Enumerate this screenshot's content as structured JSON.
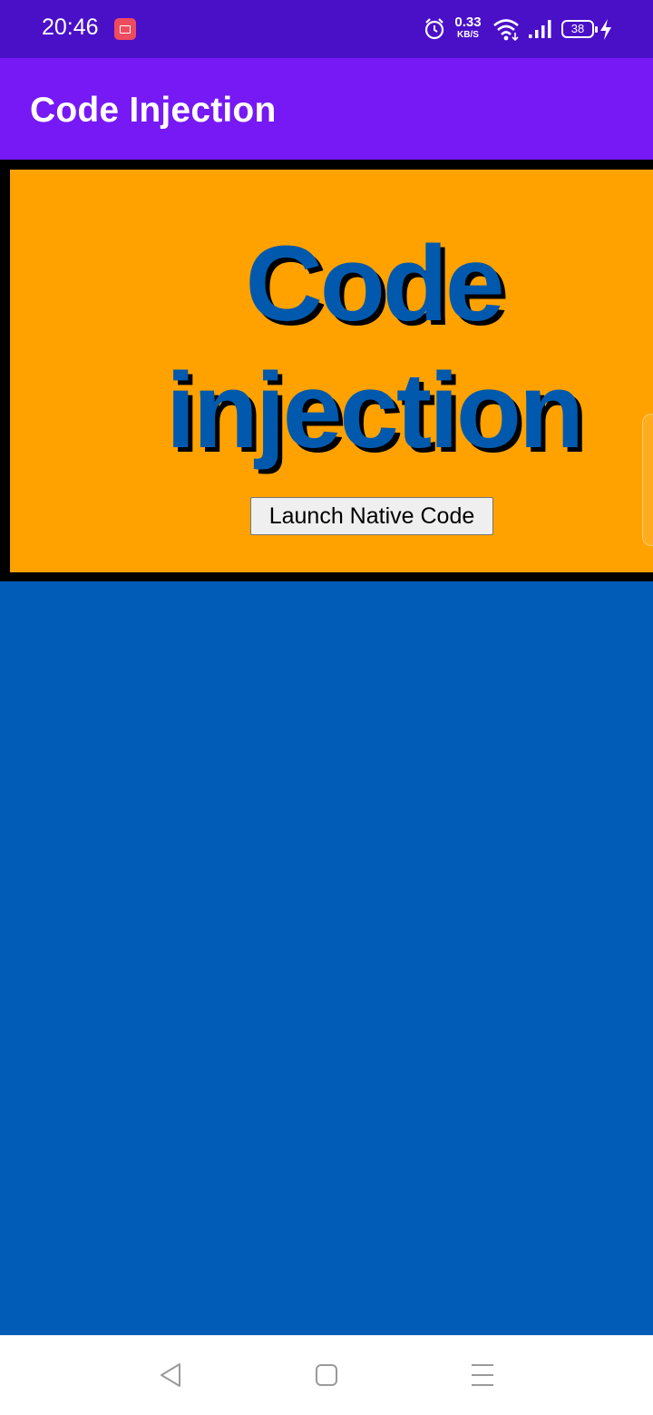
{
  "status_bar": {
    "time": "20:46",
    "network_speed_value": "0.33",
    "network_speed_unit": "KB/S",
    "battery_level": "38",
    "icons": [
      "screen-record-icon",
      "alarm-icon",
      "wifi-icon",
      "signal-icon",
      "battery-icon",
      "charging-icon"
    ]
  },
  "app_bar": {
    "title": "Code Injection"
  },
  "web_content": {
    "heading_line1": "Code",
    "heading_line2": "injection",
    "button_label": "Launch Native Code",
    "colors": {
      "banner_background": "#ffa200",
      "banner_border": "#000000",
      "heading_text": "#0059ad",
      "page_background": "#005cb6"
    }
  },
  "navigation_bar": {
    "buttons": [
      "back-icon",
      "home-icon",
      "recents-menu-icon"
    ]
  },
  "colors": {
    "status_bar": "#4a10c8",
    "app_bar": "#7619f4"
  }
}
